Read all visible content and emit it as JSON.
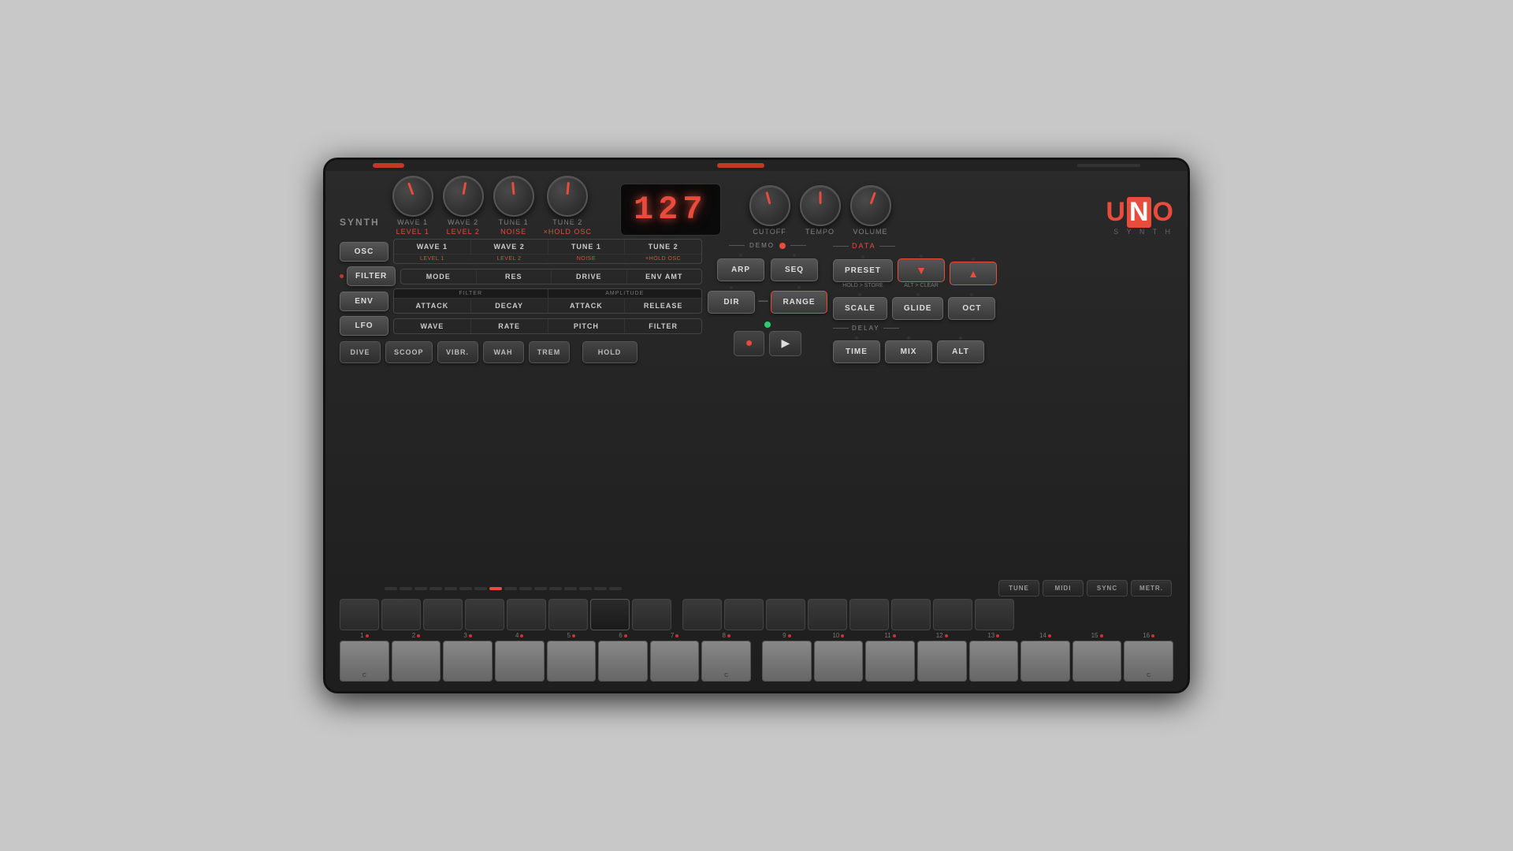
{
  "synth": {
    "label": "SYNTH",
    "display": "127",
    "logo_uno": "UNO",
    "logo_synth": "S Y N T H"
  },
  "knobs": {
    "left_group": [
      {
        "id": "wave1",
        "label": "WAVE 1",
        "sublabel": "LEVEL 1",
        "class": "wave1"
      },
      {
        "id": "wave2",
        "label": "WAVE 2",
        "sublabel": "LEVEL 2",
        "class": "wave2"
      },
      {
        "id": "tune1",
        "label": "TUNE 1",
        "sublabel": "NOISE",
        "class": "tune1"
      },
      {
        "id": "tune2",
        "label": "TUNE 2",
        "sublabel": "×HOLD OSC",
        "class": "tune2"
      }
    ],
    "right_group": [
      {
        "id": "cutoff",
        "label": "CUTOFF",
        "class": "cutoff"
      },
      {
        "id": "tempo",
        "label": "TEMPO",
        "class": "tempo"
      },
      {
        "id": "volume",
        "label": "VOLUME",
        "class": "volume"
      }
    ]
  },
  "section_buttons": [
    {
      "id": "osc",
      "label": "OSC"
    },
    {
      "id": "filter",
      "label": "FILTER"
    },
    {
      "id": "env",
      "label": "ENV"
    },
    {
      "id": "lfo",
      "label": "LFO"
    }
  ],
  "params": {
    "osc": {
      "main": [
        "WAVE 1",
        "WAVE 2",
        "TUNE 1",
        "TUNE 2"
      ],
      "sub": [
        "LEVEL 1",
        "LEVEL 2",
        "NOISE",
        "×HOLD OSC"
      ]
    },
    "filter": {
      "main": [
        "MODE",
        "RES",
        "DRIVE",
        "ENV AMT"
      ],
      "section": "FILTER"
    },
    "env": {
      "filter_section": "FILTER",
      "amplitude_section": "AMPLITUDE",
      "main": [
        "ATTACK",
        "DECAY",
        "ATTACK",
        "RELEASE"
      ]
    },
    "lfo": {
      "main": [
        "WAVE",
        "RATE",
        "PITCH",
        "FILTER"
      ]
    }
  },
  "modulation_buttons": [
    {
      "id": "dive",
      "label": "DIVE"
    },
    {
      "id": "scoop",
      "label": "SCOOP"
    },
    {
      "id": "vibr",
      "label": "VIBR."
    },
    {
      "id": "wah",
      "label": "WAH"
    },
    {
      "id": "trem",
      "label": "TREM"
    }
  ],
  "transport": {
    "hold_label": "HOLD",
    "record_icon": "●",
    "play_icon": "▶"
  },
  "arp_seq": {
    "demo_label": "DEMO",
    "arp_label": "ARP",
    "seq_label": "SEQ"
  },
  "center_controls": {
    "dir_label": "DIR",
    "range_label": "RANGE",
    "arrow_between": "—"
  },
  "right_controls": {
    "data_label": "DATA",
    "preset_label": "PRESET",
    "hold_store": "HOLD > STORE",
    "alt_clear": "ALT > CLEAR",
    "arrow_down": "▼",
    "arrow_up": "▲",
    "scale_label": "SCALE",
    "glide_label": "GLIDE",
    "oct_label": "OCT"
  },
  "delay": {
    "label": "DELAY",
    "time_label": "TIME",
    "mix_label": "MIX",
    "alt_label": "ALT"
  },
  "utility": {
    "tune_label": "TUNE",
    "midi_label": "MIDI",
    "sync_label": "SYNC",
    "metr_label": "METR."
  },
  "step_keys": [
    {
      "num": "1",
      "c_label": "C"
    },
    {
      "num": "2"
    },
    {
      "num": "3"
    },
    {
      "num": "4"
    },
    {
      "num": "5"
    },
    {
      "num": "6"
    },
    {
      "num": "7"
    },
    {
      "num": "8",
      "c_label": "C"
    },
    {
      "num": "9"
    },
    {
      "num": "10"
    },
    {
      "num": "11"
    },
    {
      "num": "12"
    },
    {
      "num": "13"
    },
    {
      "num": "14"
    },
    {
      "num": "15"
    },
    {
      "num": "16",
      "c_label": "C"
    }
  ]
}
